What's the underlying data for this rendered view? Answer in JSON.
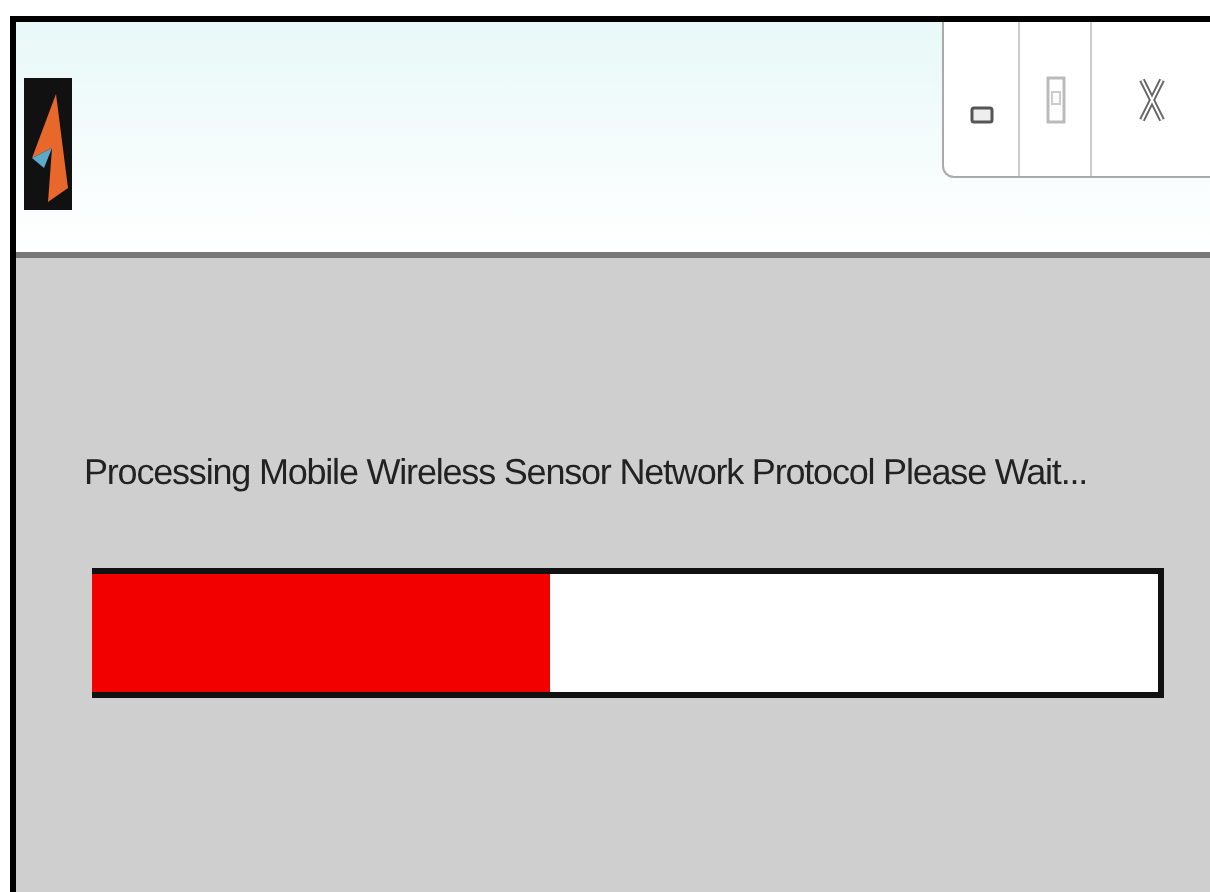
{
  "window": {
    "message": "Processing Mobile Wireless Sensor Network Protocol Please Wait..."
  },
  "progress": {
    "level": 0.43
  }
}
